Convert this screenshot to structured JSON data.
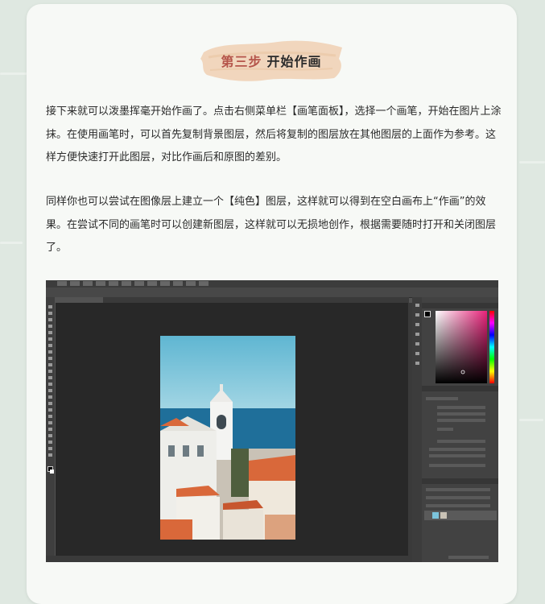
{
  "heading": {
    "step": "第三步",
    "title": "开始作画"
  },
  "paragraphs": [
    "接下来就可以泼墨挥毫开始作画了。点击右侧菜单栏【画笔面板】，选择一个画笔，开始在图片上涂抹。在使用画笔时，可以首先复制背景图层，然后将复制的图层放在其他图层的上面作为参考。这样方便快速打开此图层，对比作画后和原图的差别。",
    "同样你也可以尝试在图像层上建立一个【纯色】图层，这样就可以得到在空白画布上“作画”的效果。在尝试不同的画笔时可以创建新图层，这样就可以无损地创作，根据需要随时打开和关闭图层了。"
  ],
  "colors": {
    "step": "#b5554a",
    "brush": "#f1d6bd",
    "sea": "#1f6f9a",
    "sky": "#7cc4dc",
    "roof": "#d9683a"
  }
}
